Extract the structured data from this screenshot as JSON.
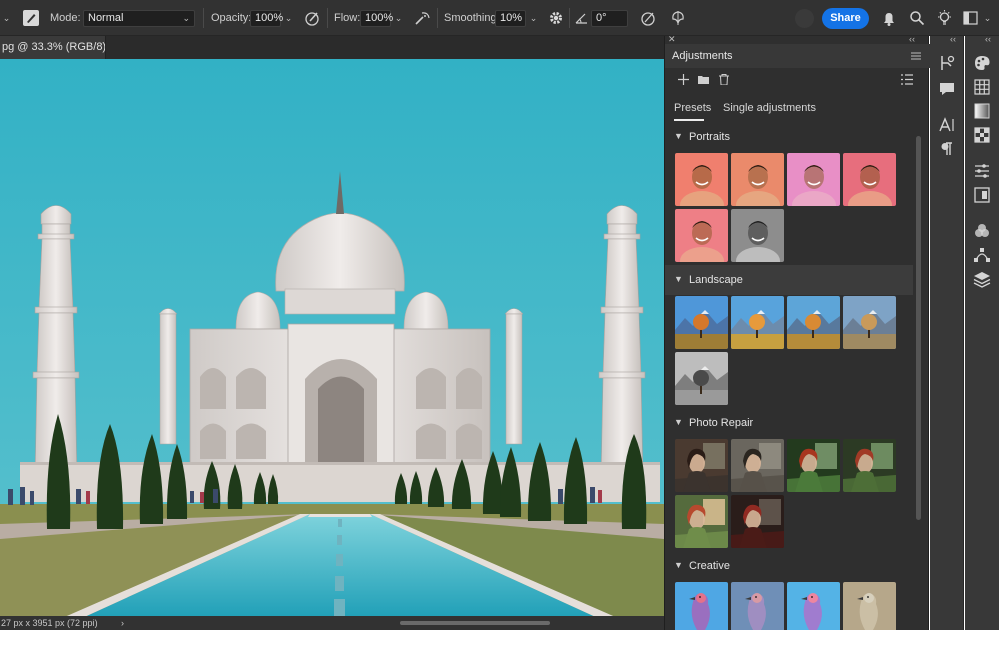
{
  "options_bar": {
    "mode_label": "Mode:",
    "mode_value": "Normal",
    "opacity_label": "Opacity:",
    "opacity_value": "100%",
    "flow_label": "Flow:",
    "flow_value": "100%",
    "smoothing_label": "Smoothing:",
    "smoothing_value": "10%",
    "angle_value": "0°",
    "share_label": "Share",
    "icons": [
      "brush-preset-icon",
      "pressure-opacity-icon",
      "airbrush-icon",
      "smoothing-settings-gear-icon",
      "angle-icon",
      "pressure-size-icon",
      "symmetry-icon",
      "notifications-bell-icon",
      "search-icon",
      "discover-lightbulb-icon",
      "workspace-icon"
    ]
  },
  "document": {
    "tab_label": "pg @ 33.3% (RGB/8)",
    "status_text": "27 px x 3951 px (72 ppi)",
    "status_arrow": "›"
  },
  "adjustments": {
    "title": "Adjustments",
    "tabs": [
      {
        "label": "Presets",
        "active": true
      },
      {
        "label": "Single adjustments",
        "active": false
      }
    ],
    "sections": [
      {
        "title": "Portraits",
        "count": 6
      },
      {
        "title": "Landscape",
        "count": 5
      },
      {
        "title": "Photo Repair",
        "count": 6
      },
      {
        "title": "Creative",
        "count": 4
      }
    ]
  },
  "colors": {
    "accent": "#1473e6",
    "panel_bg": "#2f2f2f",
    "toolbar_bg": "#323232",
    "sky": "#3fb4c6"
  }
}
